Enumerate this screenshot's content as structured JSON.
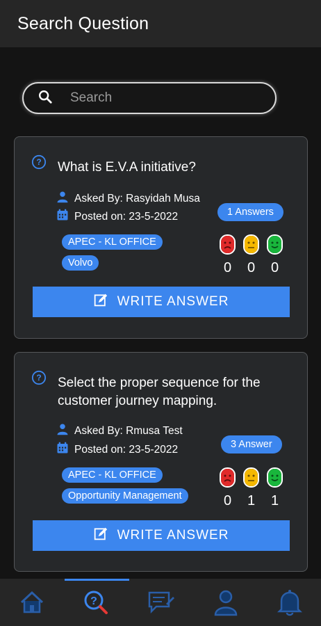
{
  "header": {
    "title": "Search Question"
  },
  "search": {
    "placeholder": "Search",
    "value": ""
  },
  "questions": [
    {
      "text": "What is E.V.A initiative?",
      "asked_by": "Asked By: Rasyidah Musa",
      "posted_on": "Posted on: 23-5-2022",
      "answers_label": "1 Answers",
      "tags": [
        "APEC - KL OFFICE",
        "Volvo"
      ],
      "reactions": {
        "sad": 0,
        "neutral": 0,
        "happy": 0
      },
      "button_label": "WRITE ANSWER"
    },
    {
      "text": "Select the proper sequence for the customer journey mapping.",
      "asked_by": "Asked By: Rmusa Test",
      "posted_on": "Posted on: 23-5-2022",
      "answers_label": "3 Answer",
      "tags": [
        "APEC - KL OFFICE",
        "Opportunity Management"
      ],
      "reactions": {
        "sad": 0,
        "neutral": 1,
        "happy": 1
      },
      "button_label": "WRITE ANSWER"
    }
  ],
  "bottom_nav": {
    "active": "search",
    "items": [
      "home-icon",
      "search-question-icon",
      "chat-icon",
      "profile-icon",
      "notification-bell-icon"
    ]
  },
  "colors": {
    "accent": "#3c86ee",
    "card": "#26282a",
    "background": "#141414",
    "sad": "#e02a2a",
    "neutral": "#f5b800",
    "happy": "#19b63c"
  }
}
